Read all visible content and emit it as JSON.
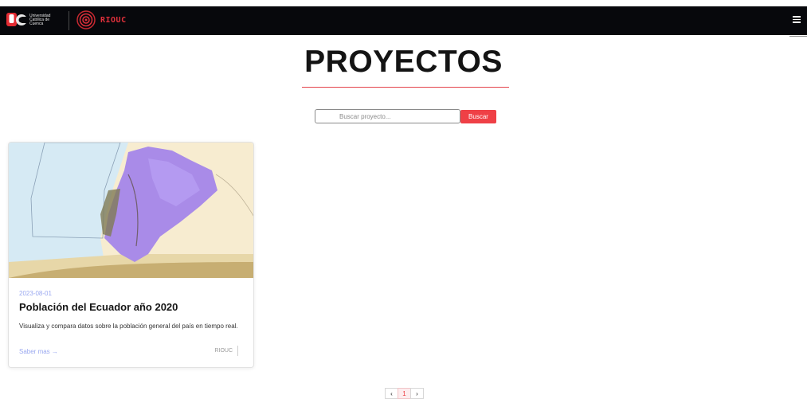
{
  "header": {
    "university_name": "Universidad Católica de Cuenca",
    "app_name": "RIOUC",
    "menu_icon": "hamburger-menu-icon"
  },
  "page": {
    "title": "PROYECTOS"
  },
  "search": {
    "placeholder": "Buscar proyecto...",
    "value": "",
    "button_label": "Buscar"
  },
  "projects": [
    {
      "date": "2023-08-01",
      "title": "Población del Ecuador año 2020",
      "description": "Visualiza y compara datos sobre la población general del país en tiempo real.",
      "link_label": "Saber mas →",
      "author": "RIOUC"
    }
  ],
  "pagination": {
    "prev_label": "‹",
    "current_page": "1",
    "next_label": "›"
  },
  "colors": {
    "accent": "#ef4046",
    "header_bg": "#07080c",
    "link": "#9aa8f0"
  }
}
